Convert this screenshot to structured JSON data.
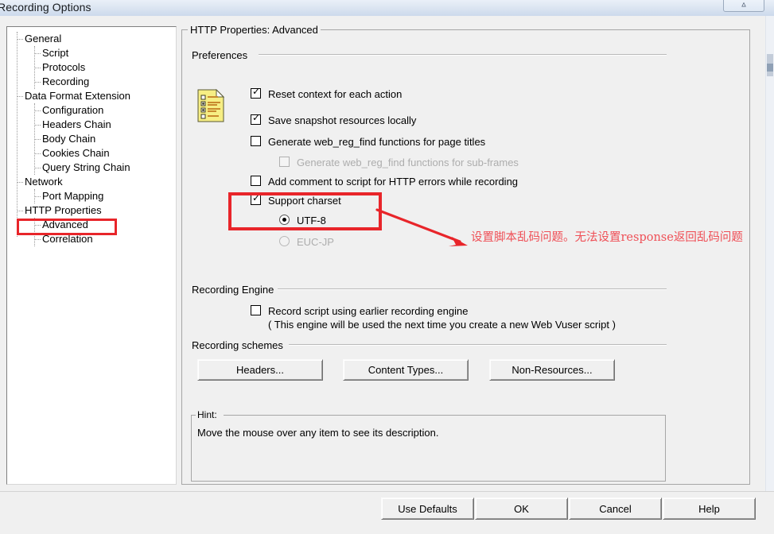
{
  "window": {
    "title": "Recording Options",
    "control_button_icon": "collapse-chevron-icon"
  },
  "sidebar": {
    "items": [
      {
        "label": "General",
        "level": 0
      },
      {
        "label": "Script",
        "level": 1
      },
      {
        "label": "Protocols",
        "level": 1
      },
      {
        "label": "Recording",
        "level": 1
      },
      {
        "label": "Data Format Extension",
        "level": 0
      },
      {
        "label": "Configuration",
        "level": 1
      },
      {
        "label": "Headers Chain",
        "level": 1
      },
      {
        "label": "Body Chain",
        "level": 1
      },
      {
        "label": "Cookies Chain",
        "level": 1
      },
      {
        "label": "Query String Chain",
        "level": 1
      },
      {
        "label": "Network",
        "level": 0
      },
      {
        "label": "Port Mapping",
        "level": 1
      },
      {
        "label": "HTTP Properties",
        "level": 0
      },
      {
        "label": "Advanced",
        "level": 1
      },
      {
        "label": "Correlation",
        "level": 1
      }
    ],
    "selected": "Advanced"
  },
  "main": {
    "group_title": "HTTP Properties: Advanced",
    "preferences": {
      "section_label": "Preferences",
      "icon": "yellow-options-document-icon",
      "options": [
        {
          "label": "Reset context for each action",
          "checked": true,
          "disabled": false
        },
        {
          "label": "Save snapshot resources locally",
          "checked": true,
          "disabled": false
        },
        {
          "label": "Generate web_reg_find functions for page titles",
          "checked": false,
          "disabled": false
        },
        {
          "label": "Generate web_reg_find functions for sub-frames",
          "checked": false,
          "disabled": true
        },
        {
          "label": "Add comment to script for HTTP errors while recording",
          "checked": false,
          "disabled": false
        },
        {
          "label": "Support charset",
          "checked": true,
          "disabled": false
        }
      ],
      "charset_radios": [
        {
          "label": "UTF-8",
          "selected": true,
          "disabled": false
        },
        {
          "label": "EUC-JP",
          "selected": false,
          "disabled": true
        }
      ]
    },
    "recording_engine": {
      "section_label": "Recording Engine",
      "option_label": "Record script using earlier recording engine",
      "option_note": "( This engine will be used the next time you create a new Web Vuser script )",
      "checked": false
    },
    "recording_schemes": {
      "section_label": "Recording schemes",
      "buttons": [
        {
          "label": "Headers..."
        },
        {
          "label": "Content Types..."
        },
        {
          "label": "Non-Resources..."
        }
      ]
    },
    "hint": {
      "legend": "Hint:",
      "text": "Move the mouse over any item to see its description."
    }
  },
  "annotation": {
    "text": "设置脚本乱码问题。无法设置response返回乱码问题",
    "color": "#ef5057",
    "highlight_color": "#e8252a"
  },
  "footer": {
    "buttons": [
      {
        "label": "Use Defaults"
      },
      {
        "label": "OK"
      },
      {
        "label": "Cancel"
      },
      {
        "label": "Help"
      }
    ]
  }
}
